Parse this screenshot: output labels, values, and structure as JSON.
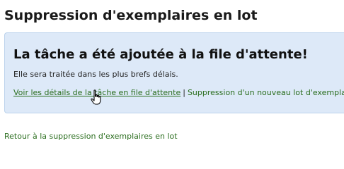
{
  "page": {
    "title": "Suppression d'exemplaires en lot"
  },
  "alert": {
    "heading": "La tâche a été ajoutée à la file d'attente!",
    "message": "Elle sera traitée dans les plus brefs délais.",
    "links": {
      "view_details": "Voir les détails de la tâche en file d'attente",
      "separator": "|",
      "new_batch": "Suppression d'un nouveau lot d'exemplaires"
    }
  },
  "footer": {
    "back_link": "Retour à la suppression d'exemplaires en lot"
  },
  "colors": {
    "link": "#2b6e1f",
    "alert_background": "#dde9f8",
    "alert_border": "#bcd3ec"
  },
  "icons": {
    "cursor": "hand-pointer-icon"
  }
}
